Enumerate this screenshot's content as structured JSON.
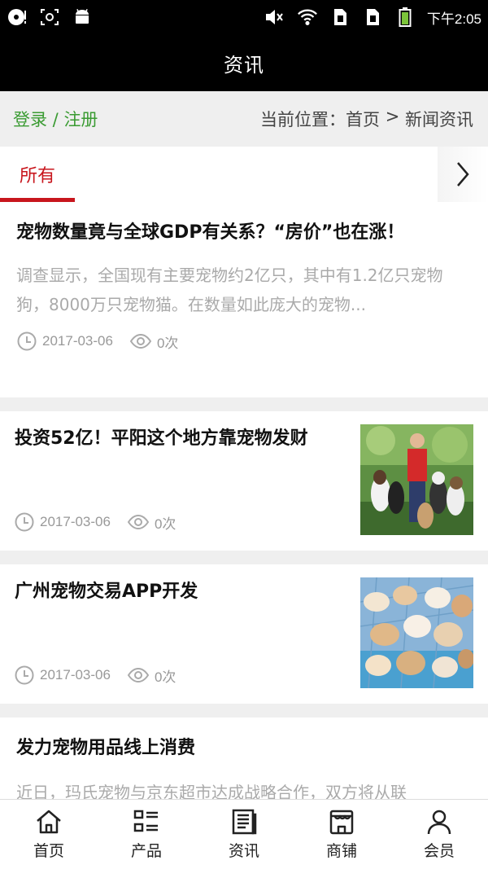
{
  "status_bar": {
    "time": "下午2:05",
    "left_icons": [
      "record-icon",
      "screenshot-icon",
      "android-icon"
    ],
    "right_icons": [
      "mute-icon",
      "wifi-icon",
      "sim1-icon",
      "sim2-icon",
      "battery-icon"
    ]
  },
  "header": {
    "title": "资讯"
  },
  "location_bar": {
    "login_label": "登录",
    "separator": " / ",
    "register_label": "注册",
    "current_prefix": "当前位置：",
    "home_link": "首页",
    "arrow": " > ",
    "current_page": "新闻资讯"
  },
  "tabs": {
    "items": [
      {
        "label": "所有",
        "active": true
      }
    ],
    "more_icon": "chevron-right-icon"
  },
  "news": [
    {
      "title": "宠物数量竟与全球GDP有关系？“房价”也在涨！",
      "summary": "调查显示，全国现有主要宠物约2亿只，其中有1.2亿只宠物狗，8000万只宠物猫。在数量如此庞大的宠物...",
      "date": "2017-03-06",
      "views": "0次",
      "image": null
    },
    {
      "title": "投资52亿！平阳这个地方靠宠物发财",
      "date": "2017-03-06",
      "views": "0次",
      "image": "man-with-dogs-photo"
    },
    {
      "title": "广州宠物交易APP开发",
      "date": "2017-03-06",
      "views": "0次",
      "image": "puppies-photo"
    },
    {
      "title": "发力宠物用品线上消费",
      "summary": "近日，玛氏宠物与京东超市达成战略合作，双方将从联",
      "image": null
    }
  ],
  "bottom_nav": [
    {
      "label": "首页",
      "icon": "home-icon"
    },
    {
      "label": "产品",
      "icon": "product-list-icon"
    },
    {
      "label": "资讯",
      "icon": "news-icon"
    },
    {
      "label": "商铺",
      "icon": "store-icon"
    },
    {
      "label": "会员",
      "icon": "member-icon"
    }
  ],
  "colors": {
    "accent": "#c8161d",
    "login_green": "#3a9b32",
    "header_bg": "#000000"
  }
}
